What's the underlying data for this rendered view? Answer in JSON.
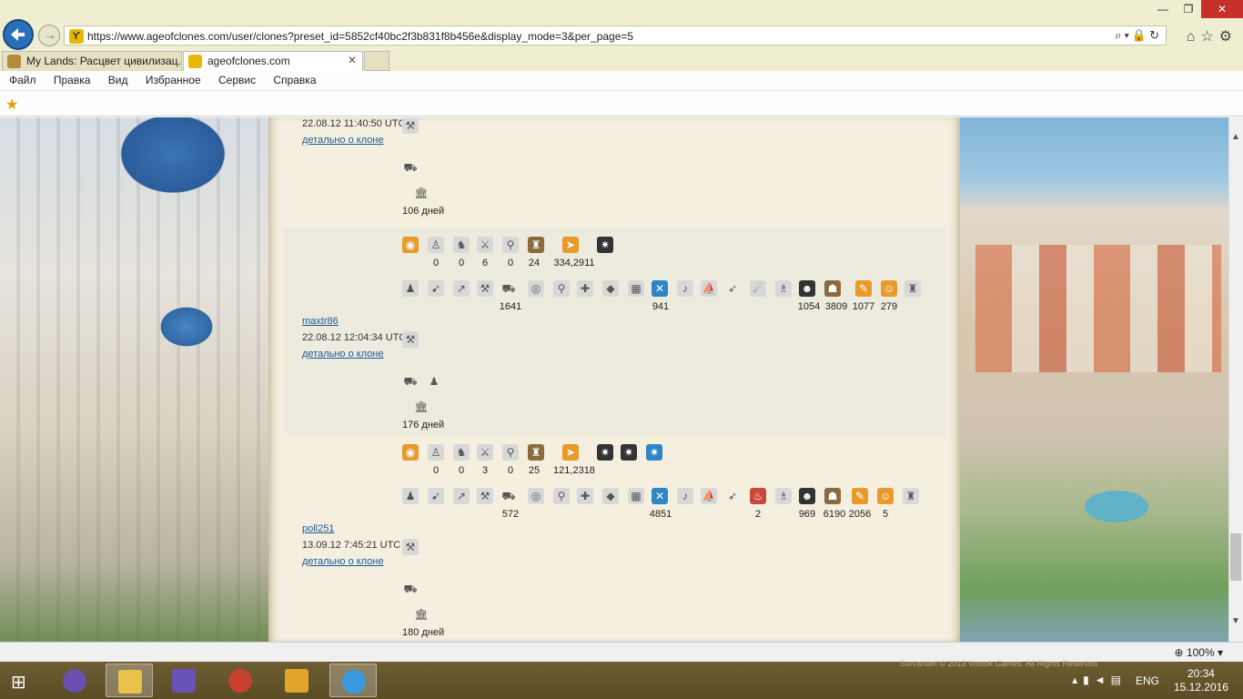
{
  "browser": {
    "url": "https://www.ageofclones.com/user/clones?preset_id=5852cf40bc2f3b831f8b456e&display_mode=3&per_page=5",
    "tabs": [
      {
        "label": "My Lands: Расцвет цивилизац..."
      },
      {
        "label": "ageofclones.com"
      }
    ],
    "menu": [
      "Файл",
      "Правка",
      "Вид",
      "Избранное",
      "Сервис",
      "Справка"
    ],
    "zoom": "100%"
  },
  "clones": [
    {
      "date": "22.08.12 11:40:50 UTC",
      "detail_label": "детально о клоне",
      "days": "106 дней"
    },
    {
      "user": "maxtr86",
      "date": "22.08.12 12:04:34 UTC",
      "detail_label": "детально о клоне",
      "res_values": [
        "0",
        "0",
        "6",
        "0",
        "24",
        "334,2911"
      ],
      "unit_values": {
        "catapult": "1641",
        "swords": "941",
        "thief": "1054",
        "guard": "3809",
        "scroll": "1077",
        "monk": "279"
      },
      "days": "176 дней"
    },
    {
      "user": "poll251",
      "date": "13.09.12 7:45:21 UTC",
      "detail_label": "детально о клоне",
      "res_values": [
        "0",
        "0",
        "3",
        "0",
        "25",
        "121,2318"
      ],
      "unit_values": {
        "catapult": "572",
        "swords": "4851",
        "potion": "2",
        "thief": "969",
        "guard": "6190",
        "scroll": "2056",
        "monk": "5"
      },
      "days": "180 дней"
    }
  ],
  "taskbar": {
    "lang": "ENG",
    "time": "20:34",
    "date": "15.12.2016",
    "note": "Survarium © 2013 Vostok Games. All Rights Reserved"
  }
}
